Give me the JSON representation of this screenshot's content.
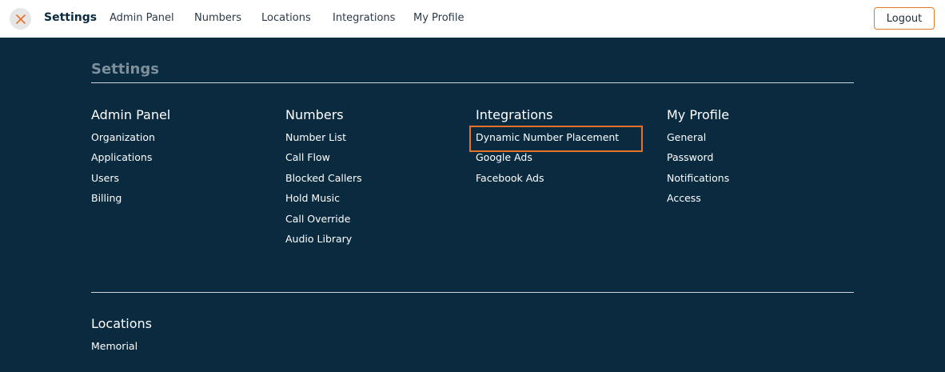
{
  "topbar": {
    "close_icon": "close-icon",
    "title": "Settings",
    "links": [
      "Admin Panel",
      "Numbers",
      "Locations",
      "Integrations",
      "My Profile"
    ],
    "logout_label": "Logout"
  },
  "colors": {
    "background": "#0a2a3f",
    "topbar": "#ffffff",
    "accent": "#e8712a",
    "muted_title": "#7e8f9c"
  },
  "page": {
    "title": "Settings"
  },
  "sections": {
    "admin_panel": {
      "title": "Admin Panel",
      "items": [
        "Organization",
        "Applications",
        "Users",
        "Billing"
      ]
    },
    "numbers": {
      "title": "Numbers",
      "items": [
        "Number List",
        "Call Flow",
        "Blocked Callers",
        "Hold Music",
        "Call Override",
        "Audio Library"
      ]
    },
    "integrations": {
      "title": "Integrations",
      "items": [
        "Dynamic Number Placement",
        "Google Ads",
        "Facebook Ads"
      ],
      "highlighted": "Dynamic Number Placement"
    },
    "my_profile": {
      "title": "My Profile",
      "items": [
        "General",
        "Password",
        "Notifications",
        "Access"
      ]
    },
    "locations": {
      "title": "Locations",
      "items": [
        "Memorial"
      ]
    }
  }
}
